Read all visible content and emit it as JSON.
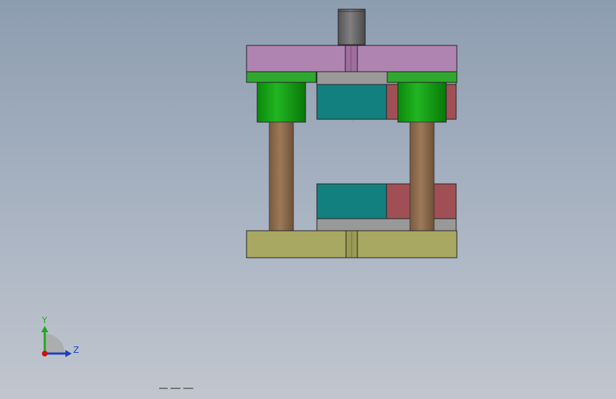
{
  "viewport": {
    "model": {
      "parts": [
        "punch",
        "upper-die-plate",
        "guide-bushing-left",
        "guide-bushing-right",
        "upper-insert",
        "lower-insert",
        "guide-pillar-left",
        "guide-pillar-right",
        "lower-die-base"
      ],
      "colors": {
        "upper_plate": "#b084b0",
        "bushing": "#1fa81f",
        "bushing_top": "#2fa82f",
        "insert_teal": "#138080",
        "insert_red": "#a05055",
        "plate_gray": "#999999",
        "pillar": "#8e6a4c",
        "punch": "#6d6d6d",
        "lower_base": "#a8a862"
      }
    },
    "triad": {
      "y_label": "Y",
      "z_label": "Z",
      "y_color": "#1fa81f",
      "z_color": "#1f3fbf",
      "origin_color": "#cc1111"
    }
  }
}
